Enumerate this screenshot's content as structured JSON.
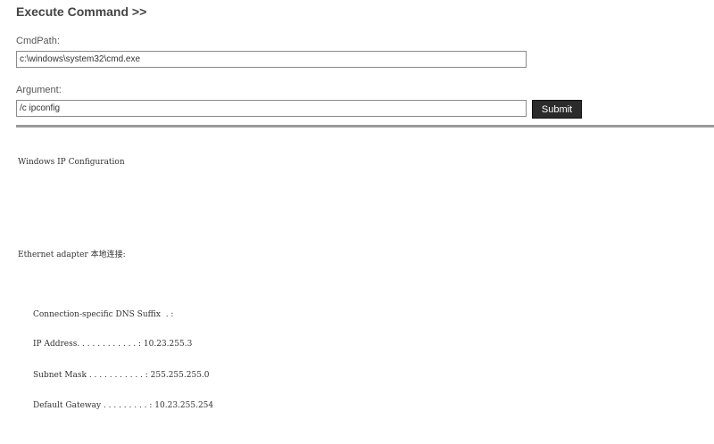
{
  "header": {
    "title": "Execute Command >>"
  },
  "form": {
    "cmdpath_label": "CmdPath:",
    "cmdpath_value": "c:\\windows\\system32\\cmd.exe",
    "argument_label": "Argument:",
    "argument_value": "/c ipconfig",
    "submit_label": "Submit"
  },
  "output": {
    "heading": "Windows IP Configuration",
    "adapter": "Ethernet adapter 本地连接:",
    "lines": [
      "Connection-specific DNS Suffix  . :",
      "IP Address. . . . . . . . . . . . : 10.23.255.3",
      "Subnet Mask . . . . . . . . . . . : 255.255.255.0",
      "Default Gateway . . . . . . . . . : 10.23.255.254"
    ]
  }
}
